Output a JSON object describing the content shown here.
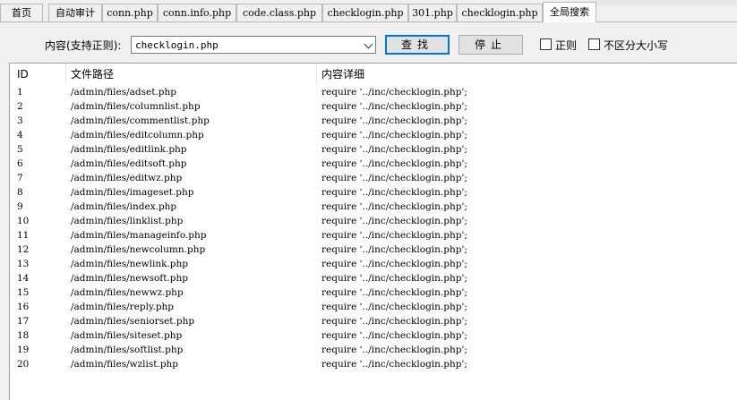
{
  "tabs": [
    {
      "label": "首页"
    },
    {
      "label": "自动审计"
    },
    {
      "label": "conn.php"
    },
    {
      "label": "conn.info.php"
    },
    {
      "label": "code.class.php"
    },
    {
      "label": "checklogin.php"
    },
    {
      "label": "301.php"
    },
    {
      "label": "checklogin.php"
    },
    {
      "label": "全局搜索"
    }
  ],
  "search": {
    "content_label": "内容(支持正则):",
    "query_value": "checklogin.php",
    "search_button": "查找",
    "stop_button": "停止",
    "regex_label": "正则",
    "case_label": "不区分大小写",
    "regex_checked": false,
    "case_checked": false
  },
  "table": {
    "headers": {
      "id": "ID",
      "path": "文件路径",
      "detail": "内容详细"
    },
    "rows": [
      {
        "id": "1",
        "path": "/admin/files/adset.php",
        "detail": "require '../inc/checklogin.php';"
      },
      {
        "id": "2",
        "path": "/admin/files/columnlist.php",
        "detail": "require '../inc/checklogin.php';"
      },
      {
        "id": "3",
        "path": "/admin/files/commentlist.php",
        "detail": "require '../inc/checklogin.php';"
      },
      {
        "id": "4",
        "path": "/admin/files/editcolumn.php",
        "detail": "require '../inc/checklogin.php';"
      },
      {
        "id": "5",
        "path": "/admin/files/editlink.php",
        "detail": "require '../inc/checklogin.php';"
      },
      {
        "id": "6",
        "path": "/admin/files/editsoft.php",
        "detail": "require '../inc/checklogin.php';"
      },
      {
        "id": "7",
        "path": "/admin/files/editwz.php",
        "detail": "require '../inc/checklogin.php';"
      },
      {
        "id": "8",
        "path": "/admin/files/imageset.php",
        "detail": "require '../inc/checklogin.php';"
      },
      {
        "id": "9",
        "path": "/admin/files/index.php",
        "detail": "require '../inc/checklogin.php';"
      },
      {
        "id": "10",
        "path": "/admin/files/linklist.php",
        "detail": "require '../inc/checklogin.php';"
      },
      {
        "id": "11",
        "path": "/admin/files/manageinfo.php",
        "detail": "require '../inc/checklogin.php';"
      },
      {
        "id": "12",
        "path": "/admin/files/newcolumn.php",
        "detail": "require '../inc/checklogin.php';"
      },
      {
        "id": "13",
        "path": "/admin/files/newlink.php",
        "detail": "require '../inc/checklogin.php';"
      },
      {
        "id": "14",
        "path": "/admin/files/newsoft.php",
        "detail": "require '../inc/checklogin.php';"
      },
      {
        "id": "15",
        "path": "/admin/files/newwz.php",
        "detail": "require '../inc/checklogin.php';"
      },
      {
        "id": "16",
        "path": "/admin/files/reply.php",
        "detail": "require '../inc/checklogin.php';"
      },
      {
        "id": "17",
        "path": "/admin/files/seniorset.php",
        "detail": "require '../inc/checklogin.php';"
      },
      {
        "id": "18",
        "path": "/admin/files/siteset.php",
        "detail": "require '../inc/checklogin.php';"
      },
      {
        "id": "19",
        "path": "/admin/files/softlist.php",
        "detail": "require '../inc/checklogin.php';"
      },
      {
        "id": "20",
        "path": "/admin/files/wzlist.php",
        "detail": "require '../inc/checklogin.php';"
      }
    ]
  }
}
